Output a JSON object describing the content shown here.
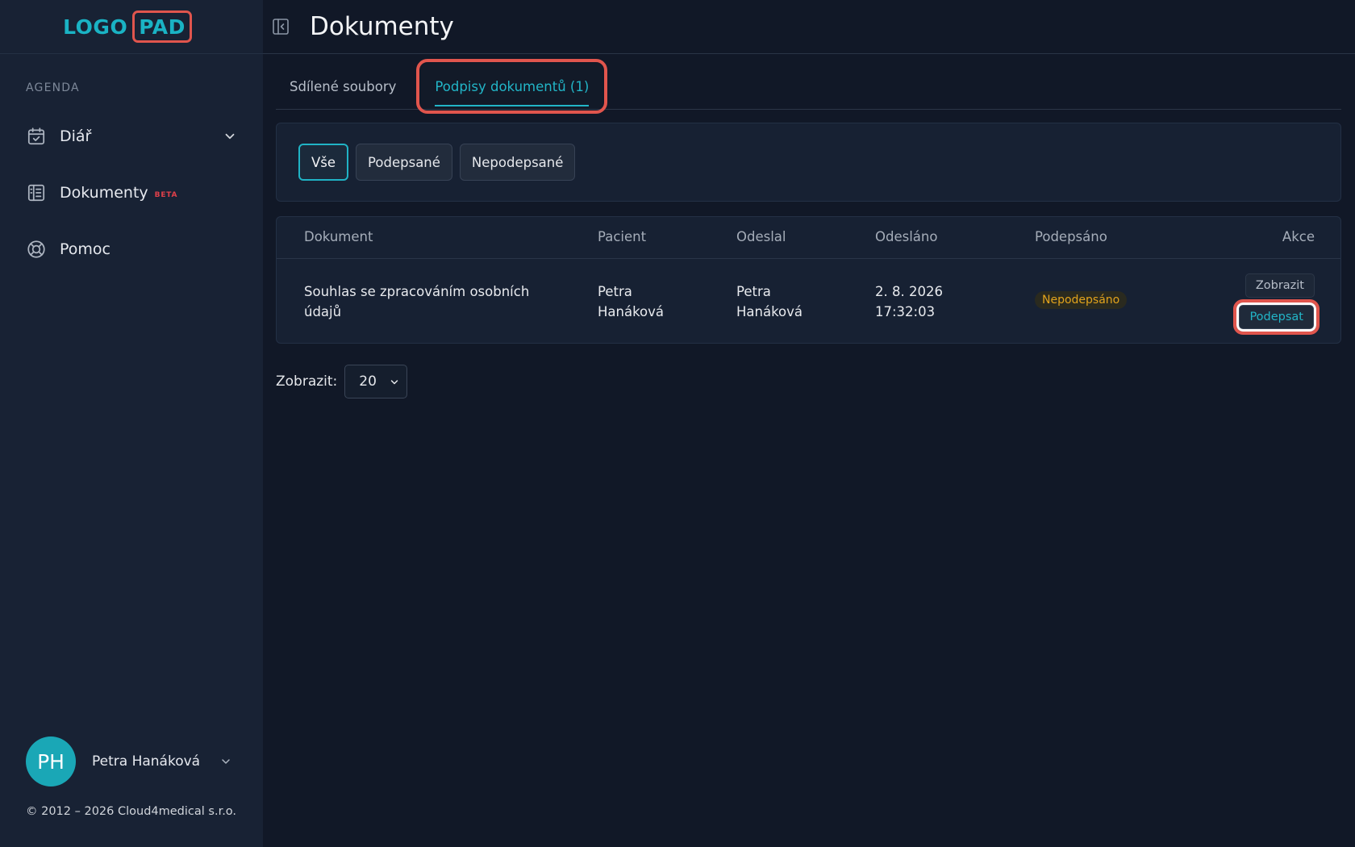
{
  "logo": {
    "part1": "LOGO",
    "part2": "PAD"
  },
  "sidebar": {
    "section_label": "AGENDA",
    "items": [
      {
        "label": "Diář",
        "icon": "calendar-check-icon",
        "has_submenu": true
      },
      {
        "label": "Dokumenty",
        "icon": "document-icon",
        "badge": "BETA"
      },
      {
        "label": "Pomoc",
        "icon": "lifebuoy-icon"
      }
    ]
  },
  "user": {
    "initials": "PH",
    "name": "Petra Hanáková"
  },
  "footer": {
    "copyright": "© 2012 – 2026 Cloud4medical s.r.o."
  },
  "header": {
    "title": "Dokumenty"
  },
  "tabs": [
    {
      "label": "Sdílené soubory",
      "active": false
    },
    {
      "label": "Podpisy dokumentů (1)",
      "active": true
    }
  ],
  "filters": [
    {
      "label": "Vše",
      "active": true
    },
    {
      "label": "Podepsané",
      "active": false
    },
    {
      "label": "Nepodepsané",
      "active": false
    }
  ],
  "table": {
    "columns": [
      "Dokument",
      "Pacient",
      "Odeslal",
      "Odesláno",
      "Podepsáno",
      "Akce"
    ],
    "rows": [
      {
        "document_line1": "Souhlas se zpracováním osobních",
        "document_line2": "údajů",
        "patient_line1": "Petra",
        "patient_line2": "Hanáková",
        "sender_line1": "Petra",
        "sender_line2": "Hanáková",
        "sent_date": "2. 8. 2026",
        "sent_time": "17:32:03",
        "status": "Nepodepsáno",
        "action_view": "Zobrazit",
        "action_sign": "Podepsat"
      }
    ]
  },
  "pagination": {
    "label": "Zobrazit:",
    "per_page": "20"
  },
  "colors": {
    "accent": "#22b5c7",
    "highlight": "#e0554d",
    "warning": "#e2a31c",
    "beta": "#e0404a"
  }
}
